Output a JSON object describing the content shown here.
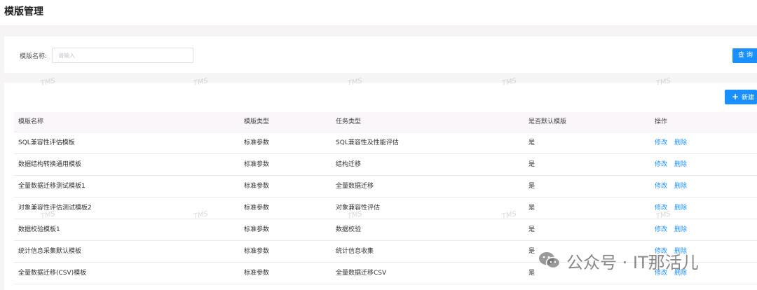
{
  "header": {
    "title": "模版管理"
  },
  "search": {
    "label": "模版名称:",
    "placeholder": "请输入",
    "query_label": "查询"
  },
  "toolbar": {
    "new_label": "新建"
  },
  "table": {
    "columns": [
      "模版名称",
      "模版类型",
      "任务类型",
      "是否默认模版",
      "操作"
    ],
    "rows": [
      {
        "name": "SQL兼容性评估模板",
        "template_type": "标准参数",
        "task_type": "SQL兼容性及性能评估",
        "is_default": "是"
      },
      {
        "name": "数据结构转换通用模板",
        "template_type": "标准参数",
        "task_type": "结构迁移",
        "is_default": "是"
      },
      {
        "name": "全量数据迁移测试模板1",
        "template_type": "标准参数",
        "task_type": "全量数据迁移",
        "is_default": "是"
      },
      {
        "name": "对象兼容性评估测试模板2",
        "template_type": "标准参数",
        "task_type": "对象兼容性评估",
        "is_default": "是"
      },
      {
        "name": "数据校验模板1",
        "template_type": "标准参数",
        "task_type": "数据校验",
        "is_default": "是"
      },
      {
        "name": "统计信息采集默认模板",
        "template_type": "标准参数",
        "task_type": "统计信息收集",
        "is_default": "是"
      },
      {
        "name": "全量数据迁移(CSV)模板",
        "template_type": "标准参数",
        "task_type": "全量数据迁移CSV",
        "is_default": "是"
      }
    ],
    "actions": {
      "edit": "修改",
      "delete": "删除"
    }
  },
  "watermark": {
    "text": "TMS",
    "brand": "公众号 · IT那活儿"
  },
  "colors": {
    "primary": "#1890ff",
    "background": "#f7f4f6"
  }
}
